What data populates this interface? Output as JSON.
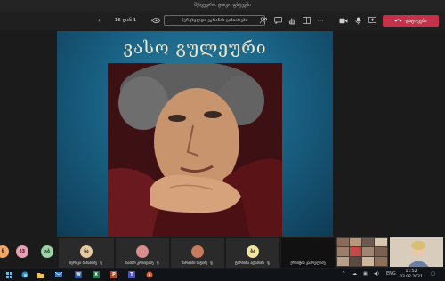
{
  "window": {
    "title": "შეხვედრა: ტაიკო ფსტევში"
  },
  "toolbar": {
    "page_label": "16-დან 1",
    "share_label": "ჩერცხვლდა ეკრანის გაზიარება",
    "leave_label": "დატოვება"
  },
  "slide": {
    "title": "ვასო გულეური"
  },
  "participants": [
    {
      "initials": "ნ",
      "color": "#f0a86a"
    },
    {
      "initials": "ბ3",
      "color": "#e9a0b4"
    },
    {
      "initials": "გბ",
      "color": "#9ad3a5"
    },
    {
      "initials": "ნა",
      "name": "მერიკი ბანაბიძე",
      "color": "#e8c9a0"
    },
    {
      "initials": "",
      "name": "თამარ კოზიდაძე",
      "color": "#d98c8c"
    },
    {
      "initials": "",
      "name": "მარიამი ნაჭიძე",
      "color": "#c77a5c"
    },
    {
      "initials": "ბა",
      "name": "ტარსინა ადამიძა",
      "color": "#f0e4a0"
    },
    {
      "name": "ქრისტინ კაპრელიძე"
    }
  ],
  "taskbar": {
    "time": "11:52",
    "date": "03.02.2021"
  }
}
